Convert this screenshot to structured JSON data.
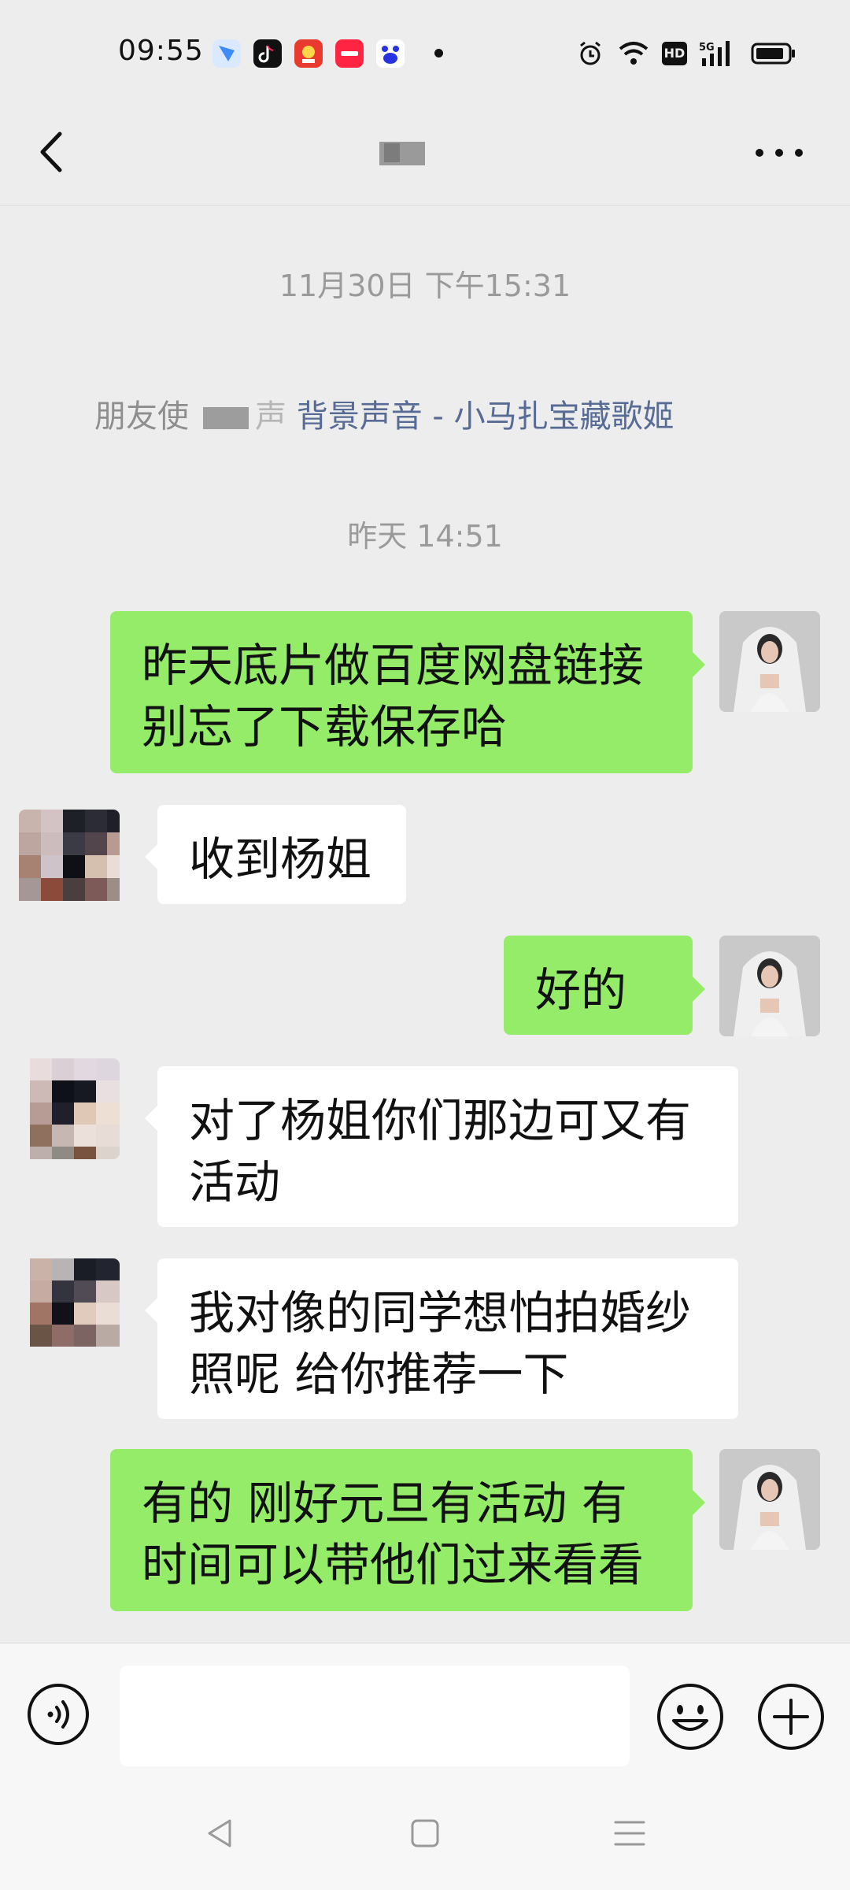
{
  "status_bar": {
    "time": "09:55",
    "network": "5G",
    "hd_label": "HD",
    "app_icons": [
      "feishu-icon",
      "tiktok-icon",
      "app-red-icon",
      "xiaohongshu-icon",
      "baidu-icon"
    ]
  },
  "chat": {
    "title": "",
    "back_icon": "chevron-left-icon",
    "more_icon": "more-horizontal-icon"
  },
  "system_messages": {
    "timestamp_1": "11月30日 下午15:31",
    "share_prefix": "朋友使",
    "share_suffix": "声",
    "share_link": "背景声音 - 小马扎宝藏歌姬",
    "timestamp_2": "昨天 14:51"
  },
  "messages": [
    {
      "sender": "me",
      "lines": [
        "昨天底片做百度网盘链接",
        "别忘了下载保存哈"
      ]
    },
    {
      "sender": "friend",
      "lines": [
        "收到杨姐"
      ]
    },
    {
      "sender": "me",
      "lines": [
        "好的"
      ]
    },
    {
      "sender": "friend",
      "lines": [
        "对了杨姐你们那边可又有",
        "活动"
      ]
    },
    {
      "sender": "friend",
      "lines": [
        "我对像的同学想怕拍婚纱",
        "照呢  给你推荐一下"
      ]
    },
    {
      "sender": "me",
      "lines": [
        "有的  刚好元旦有活动  有",
        "时间可以带他们过来看看"
      ]
    }
  ],
  "input_bar": {
    "placeholder": "",
    "voice_icon": "voice-icon",
    "emoji_icon": "emoji-icon",
    "plus_icon": "plus-circle-icon"
  },
  "colors": {
    "background": "#ededed",
    "outgoing_bubble": "#95ec69",
    "incoming_bubble": "#ffffff",
    "link": "#576b95"
  }
}
